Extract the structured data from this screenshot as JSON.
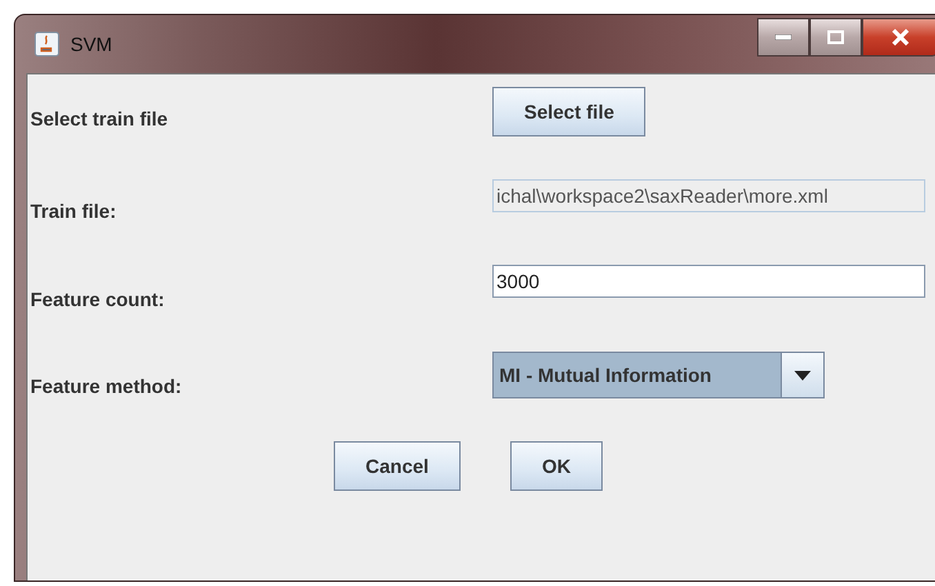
{
  "window": {
    "title": "SVM"
  },
  "rows": [
    {
      "label": "Select train file",
      "kind": "button",
      "text": "Select file"
    },
    {
      "label": "Train file:",
      "kind": "field",
      "value": "ichal\\workspace2\\saxReader\\more.xml",
      "disabled": true
    },
    {
      "label": "Feature count:",
      "kind": "field",
      "value": "3000",
      "disabled": false
    },
    {
      "label": "Feature method:",
      "kind": "combo",
      "value": "MI - Mutual Information",
      "focused": true
    }
  ],
  "buttons": [
    "Cancel",
    "OK"
  ]
}
